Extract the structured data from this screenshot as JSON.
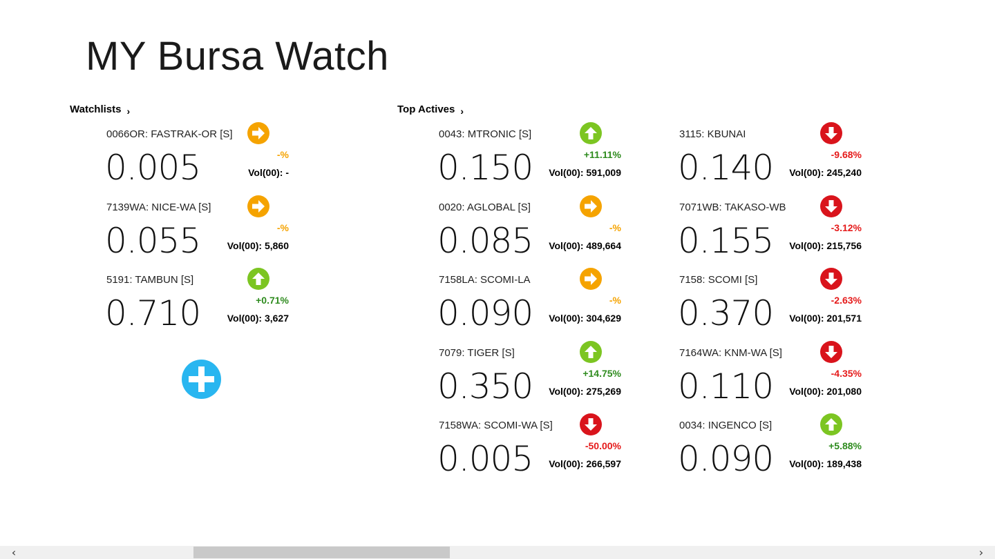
{
  "app": {
    "title": "MY Bursa Watch"
  },
  "sections": {
    "watchlists": {
      "label": "Watchlists",
      "chevron": "›"
    },
    "top_actives": {
      "label": "Top Actives",
      "chevron": "›"
    }
  },
  "vol_label": "Vol(00): ",
  "watchlist": [
    {
      "name": "0066OR: FASTRAK-OR [S]",
      "price": "0.005",
      "change": "-%",
      "volume": "-",
      "trend": "flat"
    },
    {
      "name": "7139WA: NICE-WA [S]",
      "price": "0.055",
      "change": "-%",
      "volume": "5,860",
      "trend": "flat"
    },
    {
      "name": "5191: TAMBUN [S]",
      "price": "0.710",
      "change": "+0.71%",
      "volume": "3,627",
      "trend": "up"
    }
  ],
  "top_actives_col1": [
    {
      "name": "0043: MTRONIC [S]",
      "price": "0.150",
      "change": "+11.11%",
      "volume": "591,009",
      "trend": "up"
    },
    {
      "name": "0020: AGLOBAL [S]",
      "price": "0.085",
      "change": "-%",
      "volume": "489,664",
      "trend": "flat"
    },
    {
      "name": "7158LA: SCOMI-LA",
      "price": "0.090",
      "change": "-%",
      "volume": "304,629",
      "trend": "flat"
    },
    {
      "name": "7079: TIGER [S]",
      "price": "0.350",
      "change": "+14.75%",
      "volume": "275,269",
      "trend": "up"
    },
    {
      "name": "7158WA: SCOMI-WA [S]",
      "price": "0.005",
      "change": "-50.00%",
      "volume": "266,597",
      "trend": "down"
    }
  ],
  "top_actives_col2": [
    {
      "name": "3115: KBUNAI",
      "price": "0.140",
      "change": "-9.68%",
      "volume": "245,240",
      "trend": "down"
    },
    {
      "name": "7071WB: TAKASO-WB",
      "price": "0.155",
      "change": "-3.12%",
      "volume": "215,756",
      "trend": "down"
    },
    {
      "name": "7158: SCOMI [S]",
      "price": "0.370",
      "change": "-2.63%",
      "volume": "201,571",
      "trend": "down"
    },
    {
      "name": "7164WA: KNM-WA [S]",
      "price": "0.110",
      "change": "-4.35%",
      "volume": "201,080",
      "trend": "down"
    },
    {
      "name": "0034: INGENCO [S]",
      "price": "0.090",
      "change": "+5.88%",
      "volume": "189,438",
      "trend": "up"
    }
  ],
  "colors": {
    "up": "#7cc522",
    "down": "#d9141c",
    "flat": "#f5a300",
    "add": "#29b6f0"
  },
  "icons": {
    "up": "arrow-up-icon",
    "down": "arrow-down-icon",
    "flat": "arrow-right-icon",
    "add": "plus-icon"
  },
  "scrollbar": {
    "left": "‹",
    "right": "›"
  }
}
